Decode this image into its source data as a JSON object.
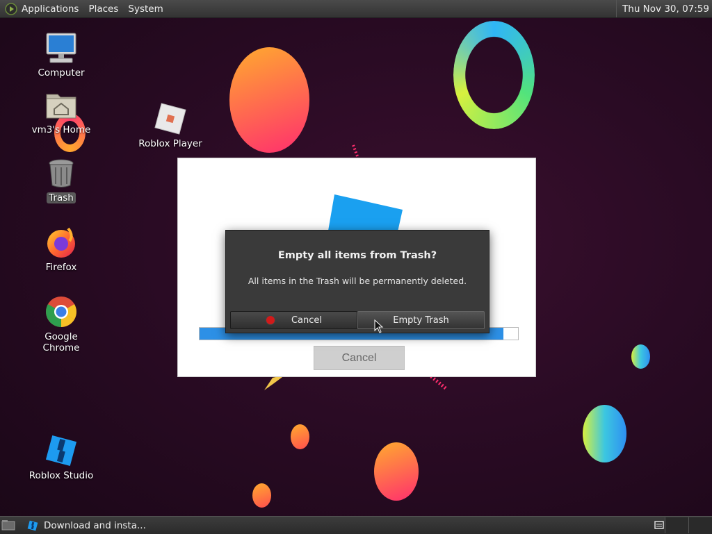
{
  "top_panel": {
    "menus": [
      "Applications",
      "Places",
      "System"
    ],
    "clock": "Thu Nov 30, 07:59"
  },
  "desktop_icons": [
    {
      "label": "Computer",
      "icon": "computer-icon"
    },
    {
      "label": "vm3's Home",
      "icon": "home-folder-icon"
    },
    {
      "label": "Trash",
      "icon": "trash-icon",
      "selected": true
    },
    {
      "label": "Firefox",
      "icon": "firefox-icon"
    },
    {
      "label": "Google Chrome",
      "icon": "chrome-icon"
    },
    {
      "label": "Roblox Studio",
      "icon": "roblox-studio-icon"
    },
    {
      "label": "Roblox Player",
      "icon": "roblox-player-icon"
    }
  ],
  "installer": {
    "progress": 0.955,
    "cancel_label": "Cancel",
    "accent": "#2d90e6"
  },
  "dialog": {
    "title": "Empty all items from Trash?",
    "message": "All items in the Trash will be permanently deleted.",
    "cancel_label": "Cancel",
    "confirm_label": "Empty Trash"
  },
  "taskbar": {
    "task_label": "Download and insta..."
  }
}
